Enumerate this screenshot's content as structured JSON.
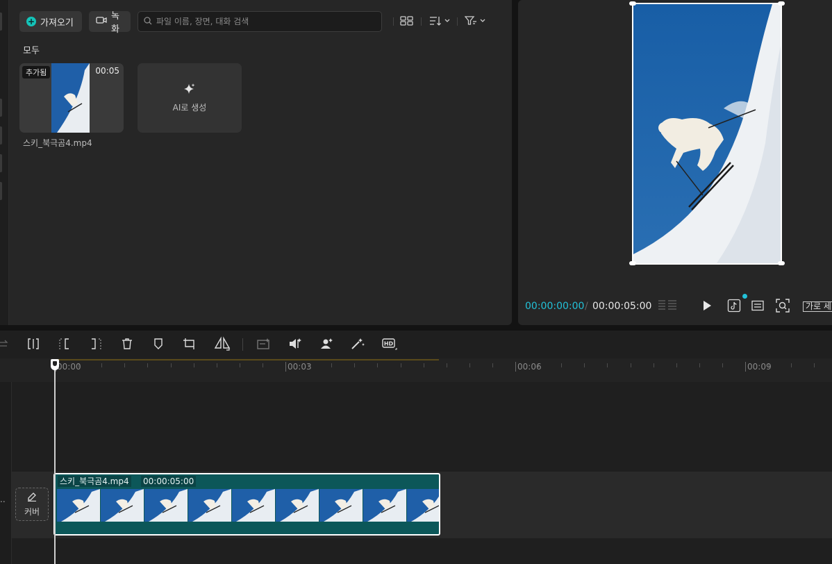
{
  "media": {
    "import_label": "가져오기",
    "record_label": "녹화",
    "search_placeholder": "파일 이름, 장면, 대화 검색",
    "section_label": "모두",
    "items": [
      {
        "name": "스키_북극곰4.mp4",
        "badge": "추가됨",
        "duration": "00:05"
      }
    ],
    "ai_card_label": "AI로 생성"
  },
  "player": {
    "current_time": "00:00:00:00",
    "time_separator": "/",
    "total_time": "00:00:05:00",
    "ratio_label": "가로 세"
  },
  "timeline": {
    "ruler": [
      "00:00",
      "00:03",
      "00:06",
      "00:09"
    ],
    "cover_label": "커버",
    "clip": {
      "name": "스키_북극곰4.mp4",
      "duration": "00:00:05:00",
      "frame_count": 9
    }
  },
  "colors": {
    "accent": "#22c1d8",
    "clip": "#0c5759",
    "sky": "#1f5fa8"
  },
  "icons": {
    "toolbar": [
      "grid-view-icon",
      "sort-icon",
      "filter-icon"
    ],
    "player": [
      "play-icon",
      "tiktok-icon",
      "subtitle-icon",
      "zoom-fit-icon"
    ],
    "timeline_tools": [
      "split-icon",
      "split-left-icon",
      "split-right-icon",
      "delete-icon",
      "marker-icon",
      "crop-icon",
      "mirror-icon",
      "ai-image-icon",
      "audio-split-icon",
      "remove-bg-icon",
      "magic-icon",
      "hd-icon"
    ]
  }
}
